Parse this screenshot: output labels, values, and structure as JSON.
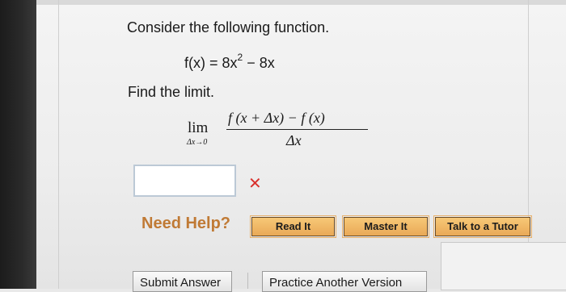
{
  "question": {
    "prompt": "Consider the following function.",
    "function_lhs": "f(x) = 8x",
    "function_exp": "2",
    "function_rest": " − 8x",
    "instruction": "Find the limit.",
    "limit_word": "lim",
    "limit_sub": "Δx→0",
    "numerator": "f (x + Δx) − f (x)",
    "denominator": "Δx"
  },
  "answer": {
    "value": "",
    "status_mark": "✕"
  },
  "help": {
    "title": "Need Help?",
    "read_it": "Read It",
    "master_it": "Master It",
    "talk_to_tutor": "Talk to a Tutor"
  },
  "actions": {
    "submit": "Submit Answer",
    "practice": "Practice Another Version"
  },
  "colors": {
    "need_help": "#c07a35",
    "incorrect_mark": "#d9302c",
    "help_button": "#f0b866"
  }
}
